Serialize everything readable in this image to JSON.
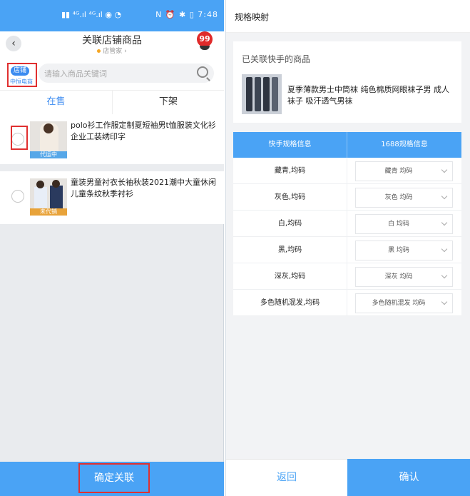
{
  "left": {
    "status": {
      "icons": "▮▮ ⁴ᴳ.ıl ⁴ᴳ.ıl ◉ ◔",
      "icons_right": "N ⏰ ✱ ▯",
      "time": "7:48"
    },
    "header": {
      "title": "关联店铺商品",
      "subtitle": "店管家",
      "badge": "99"
    },
    "search": {
      "shop_tag": "店铺",
      "shop_name": "中恒电商",
      "placeholder": "请输入商品关键词"
    },
    "tabs": {
      "on_sale": "在售",
      "off_shelf": "下架"
    },
    "products": [
      {
        "title": "polo衫工作服定制夏短袖男t恤服装文化衫企业工装绣印字",
        "tag": "代运中",
        "tag_color": "#56a7e8"
      },
      {
        "title": "童装男童衬衣长袖秋装2021潮中大童休闲儿童条纹秋季衬衫",
        "tag": "未代销",
        "tag_color": "#e8a33a"
      }
    ],
    "confirm_button": "确定关联"
  },
  "right": {
    "title": "规格映射",
    "linked_label": "已关联快手的商品",
    "product_name": "夏季薄款男士中筒袜 纯色棉质网眼袜子男 成人袜子 吸汗透气男袜",
    "table_headers": {
      "kuaishou": "快手规格信息",
      "ali1688": "1688规格信息"
    },
    "rows": [
      {
        "spec": "藏青,均码",
        "mapped": "藏青 均码"
      },
      {
        "spec": "灰色,均码",
        "mapped": "灰色 均码"
      },
      {
        "spec": "白,均码",
        "mapped": "白 均码"
      },
      {
        "spec": "黑,均码",
        "mapped": "黑 均码"
      },
      {
        "spec": "深灰,均码",
        "mapped": "深灰 均码"
      },
      {
        "spec": "多色随机混发,均码",
        "mapped": "多色随机混发 均码"
      }
    ],
    "back_button": "返回",
    "ok_button": "确认"
  },
  "colors": {
    "primary": "#4aa3f5",
    "highlight": "#e03030"
  }
}
